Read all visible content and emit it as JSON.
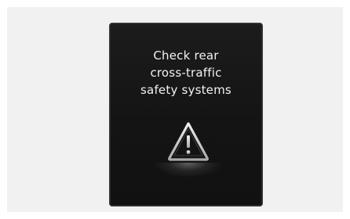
{
  "display": {
    "message_lines": [
      "Check rear",
      "cross-traffic",
      "safety systems"
    ],
    "icon": "warning-triangle-icon"
  },
  "colors": {
    "screen_background": "#141414",
    "text": "#f2f2f2",
    "icon": "#d9d9d9",
    "outer_background": "#f1f1f1"
  }
}
